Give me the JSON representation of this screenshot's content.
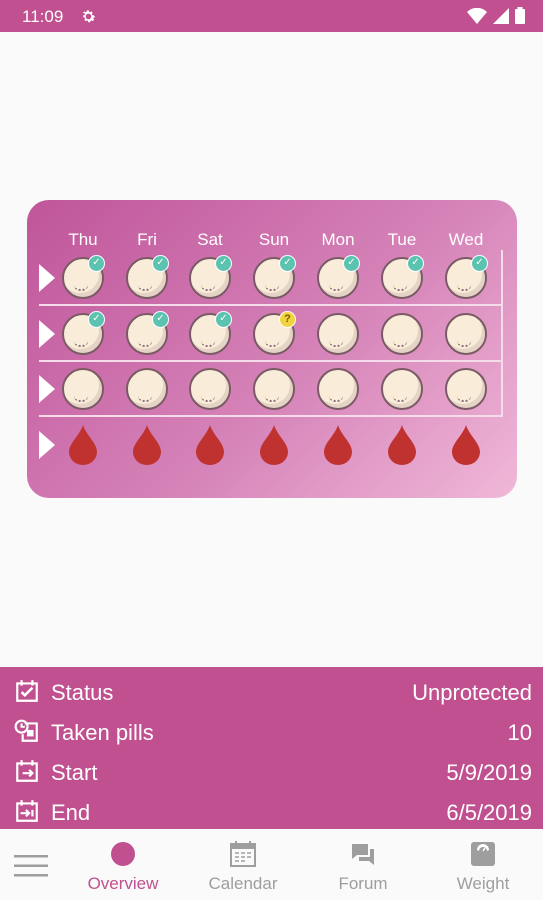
{
  "status_bar": {
    "time": "11:09",
    "icons": [
      "gear-icon",
      "wifi-icon",
      "signal-icon",
      "battery-icon"
    ]
  },
  "pack": {
    "days": [
      "Thu",
      "Fri",
      "Sat",
      "Sun",
      "Mon",
      "Tue",
      "Wed"
    ],
    "rows": [
      [
        "taken",
        "taken",
        "taken",
        "taken",
        "taken",
        "taken",
        "taken"
      ],
      [
        "taken",
        "taken",
        "taken",
        "question",
        "pill",
        "pill",
        "pill"
      ],
      [
        "pill",
        "pill",
        "pill",
        "pill",
        "pill",
        "pill",
        "pill"
      ],
      [
        "period",
        "period",
        "period",
        "period",
        "period",
        "period",
        "period"
      ]
    ],
    "colors": {
      "card_start": "#c0559a",
      "card_end": "#f0b8d8",
      "check": "#5cc3b0",
      "question": "#f1d33d",
      "drop": "#c0322f",
      "pill": "#f9ecd9"
    }
  },
  "info": {
    "rows": [
      {
        "icon": "calendar-check-icon",
        "label": "Status",
        "value": "Unprotected"
      },
      {
        "icon": "pill-clock-icon",
        "label": "Taken pills",
        "value": "10"
      },
      {
        "icon": "calendar-start-icon",
        "label": "Start",
        "value": "5/9/2019"
      },
      {
        "icon": "calendar-end-icon",
        "label": "End",
        "value": "6/5/2019"
      }
    ]
  },
  "nav": {
    "items": [
      {
        "label": "Overview",
        "icon": "circle-icon",
        "active": true
      },
      {
        "label": "Calendar",
        "icon": "calendar-icon",
        "active": false
      },
      {
        "label": "Forum",
        "icon": "chat-icon",
        "active": false
      },
      {
        "label": "Weight",
        "icon": "scale-icon",
        "active": false
      }
    ]
  },
  "accent": "#c0508f"
}
